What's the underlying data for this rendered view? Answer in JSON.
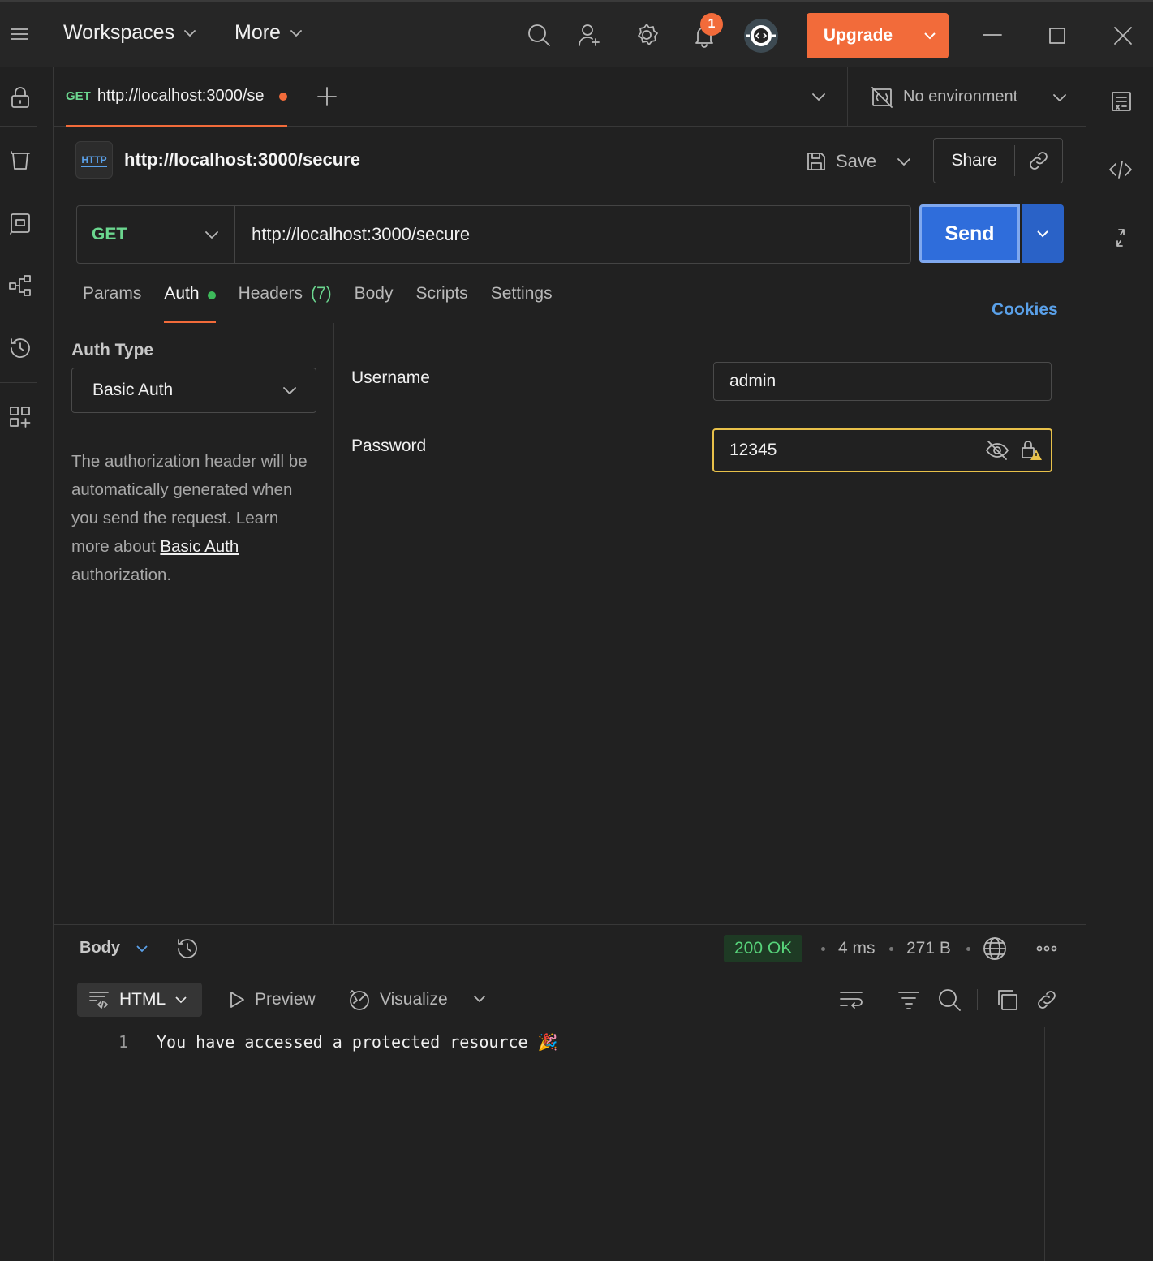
{
  "topbar": {
    "workspaces_label": "Workspaces",
    "more_label": "More",
    "notification_count": "1",
    "upgrade_label": "Upgrade"
  },
  "tabs": {
    "active_tab_method": "GET",
    "active_tab_url": "http://localhost:3000/se",
    "environment_label": "No environment"
  },
  "request": {
    "title": "http://localhost:3000/secure",
    "http_badge": "HTTP",
    "save_label": "Save",
    "share_label": "Share",
    "method": "GET",
    "url": "http://localhost:3000/secure",
    "send_label": "Send"
  },
  "subtabs": {
    "params": "Params",
    "auth": "Auth",
    "headers": "Headers",
    "headers_count": "(7)",
    "body": "Body",
    "scripts": "Scripts",
    "settings": "Settings",
    "cookies": "Cookies"
  },
  "auth": {
    "type_label": "Auth Type",
    "type_value": "Basic Auth",
    "desc_1": "The authorization header will be automatically generated when you send the request. Learn more about ",
    "desc_link": "Basic Auth",
    "desc_2": " authorization.",
    "username_label": "Username",
    "username_value": "admin",
    "password_label": "Password",
    "password_value": "12345"
  },
  "response": {
    "body_label": "Body",
    "status": "200 OK",
    "time": "4 ms",
    "size": "271 B",
    "format": "HTML",
    "preview_label": "Preview",
    "visualize_label": "Visualize",
    "line_number": "1",
    "line_text": "You have accessed a protected resource 🎉"
  },
  "colors": {
    "accent": "#f26b3a",
    "send_blue": "#2f6ddb",
    "method_green": "#6bd68f",
    "status_green": "#57d37a",
    "password_border": "#e8c14a"
  }
}
